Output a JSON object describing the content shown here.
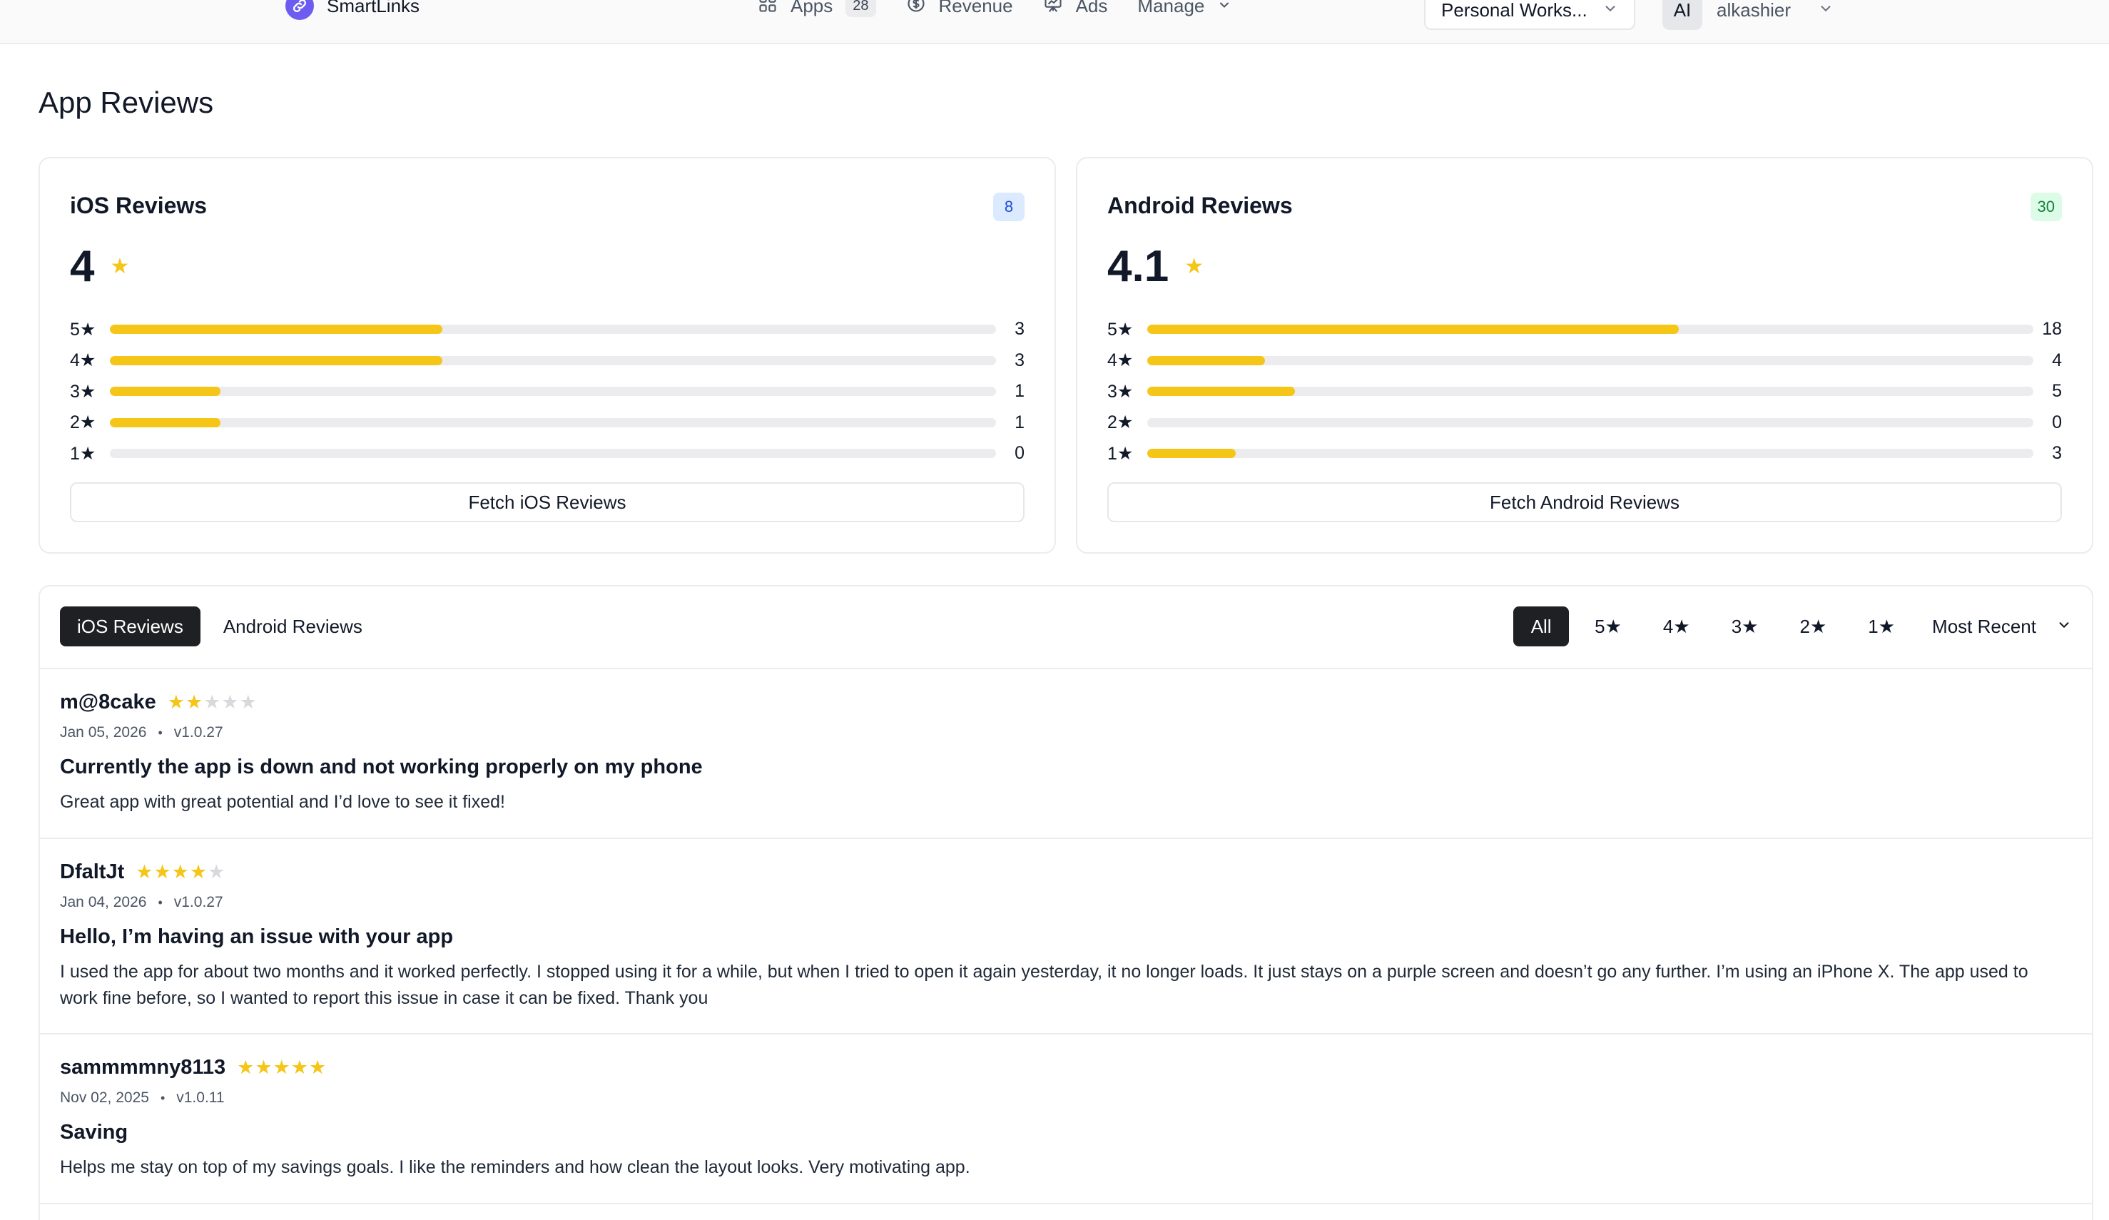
{
  "nav": {
    "brand": "SmartLinks",
    "links": [
      {
        "label": "Apps",
        "badge": "28"
      },
      {
        "label": "Revenue"
      },
      {
        "label": "Ads"
      },
      {
        "label": "Manage"
      }
    ],
    "workspace": "Personal Works...",
    "user_initials": "AI",
    "user_name": "alkashier"
  },
  "page": {
    "title": "App Reviews"
  },
  "summary": {
    "ios": {
      "title": "iOS Reviews",
      "count": "8",
      "average": "4",
      "distribution": [
        {
          "label": "5★",
          "count": 3,
          "fraction": 0.375
        },
        {
          "label": "4★",
          "count": 3,
          "fraction": 0.375
        },
        {
          "label": "3★",
          "count": 1,
          "fraction": 0.125
        },
        {
          "label": "2★",
          "count": 1,
          "fraction": 0.125
        },
        {
          "label": "1★",
          "count": 0,
          "fraction": 0
        }
      ],
      "fetch_label": "Fetch iOS Reviews"
    },
    "android": {
      "title": "Android Reviews",
      "count": "30",
      "average": "4.1",
      "distribution": [
        {
          "label": "5★",
          "count": 18,
          "fraction": 0.6
        },
        {
          "label": "4★",
          "count": 4,
          "fraction": 0.133
        },
        {
          "label": "3★",
          "count": 5,
          "fraction": 0.167
        },
        {
          "label": "2★",
          "count": 0,
          "fraction": 0
        },
        {
          "label": "1★",
          "count": 3,
          "fraction": 0.1
        }
      ],
      "fetch_label": "Fetch Android Reviews"
    }
  },
  "list": {
    "tabs": [
      {
        "label": "iOS Reviews",
        "active": true
      },
      {
        "label": "Android Reviews",
        "active": false
      }
    ],
    "filters": [
      {
        "label": "All",
        "active": true
      },
      {
        "label": "5★",
        "active": false
      },
      {
        "label": "4★",
        "active": false
      },
      {
        "label": "3★",
        "active": false
      },
      {
        "label": "2★",
        "active": false
      },
      {
        "label": "1★",
        "active": false
      }
    ],
    "sort_label": "Most Recent",
    "reviews": [
      {
        "author": "m@8cake",
        "rating": 2,
        "date": "Jan 05, 2026",
        "version": "v1.0.27",
        "title": "Currently the app is down and not working properly on my phone",
        "body": "Great app with great potential and I’d love to see it fixed!"
      },
      {
        "author": "DfaltJt",
        "rating": 4,
        "date": "Jan 04, 2026",
        "version": "v1.0.27",
        "title": "Hello, I’m having an issue with your app",
        "body": "I used the app for about two months and it worked perfectly. I stopped using it for a while, but when I tried to open it again yesterday, it no longer loads. It just stays on a purple screen and doesn’t go any further. I’m using an iPhone X. The app used to work fine before, so I wanted to report this issue in case it can be fixed. Thank you"
      },
      {
        "author": "sammmmny8113",
        "rating": 5,
        "date": "Nov 02, 2025",
        "version": "v1.0.11",
        "title": "Saving",
        "body": "Helps me stay on top of my savings goals. I like the reminders and how clean the layout looks. Very motivating app."
      }
    ]
  },
  "colors": {
    "accent": "#6d5cf0",
    "star": "#f5c518",
    "dark": "#1f2023"
  }
}
